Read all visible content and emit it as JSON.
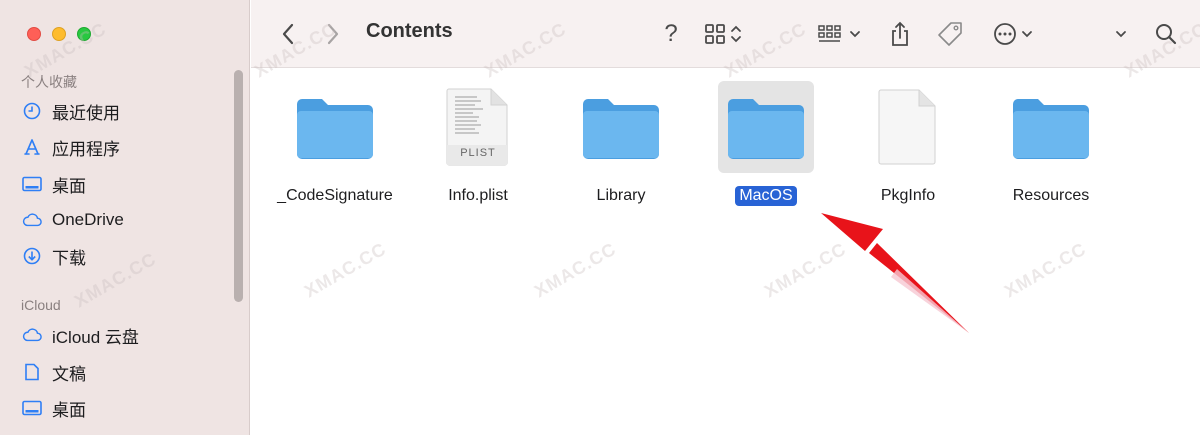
{
  "window": {
    "title": "Contents"
  },
  "sidebar": {
    "favorites_title": "个人收藏",
    "favorites": [
      {
        "label": "最近使用",
        "icon": "clock-icon"
      },
      {
        "label": "应用程序",
        "icon": "applications-icon"
      },
      {
        "label": "桌面",
        "icon": "desktop-icon"
      },
      {
        "label": "OneDrive",
        "icon": "cloud-icon"
      },
      {
        "label": "下载",
        "icon": "download-icon"
      }
    ],
    "icloud_title": "iCloud",
    "icloud": [
      {
        "label": "iCloud 云盘",
        "icon": "cloud-icon"
      },
      {
        "label": "文稿",
        "icon": "document-icon"
      },
      {
        "label": "桌面",
        "icon": "desktop-icon"
      }
    ]
  },
  "toolbar": {
    "help_glyph": "?",
    "watermark": "XMAC.CC"
  },
  "files": [
    {
      "name": "_CodeSignature",
      "kind": "folder",
      "selected": false
    },
    {
      "name": "Info.plist",
      "kind": "plist",
      "badge": "PLIST",
      "selected": false
    },
    {
      "name": "Library",
      "kind": "folder",
      "selected": false
    },
    {
      "name": "MacOS",
      "kind": "folder",
      "selected": true
    },
    {
      "name": "PkgInfo",
      "kind": "file",
      "selected": false
    },
    {
      "name": "Resources",
      "kind": "folder",
      "selected": false
    }
  ],
  "colors": {
    "accent": "#2863d5",
    "folder": "#6bb7ef",
    "arrow": "#e8131a"
  }
}
